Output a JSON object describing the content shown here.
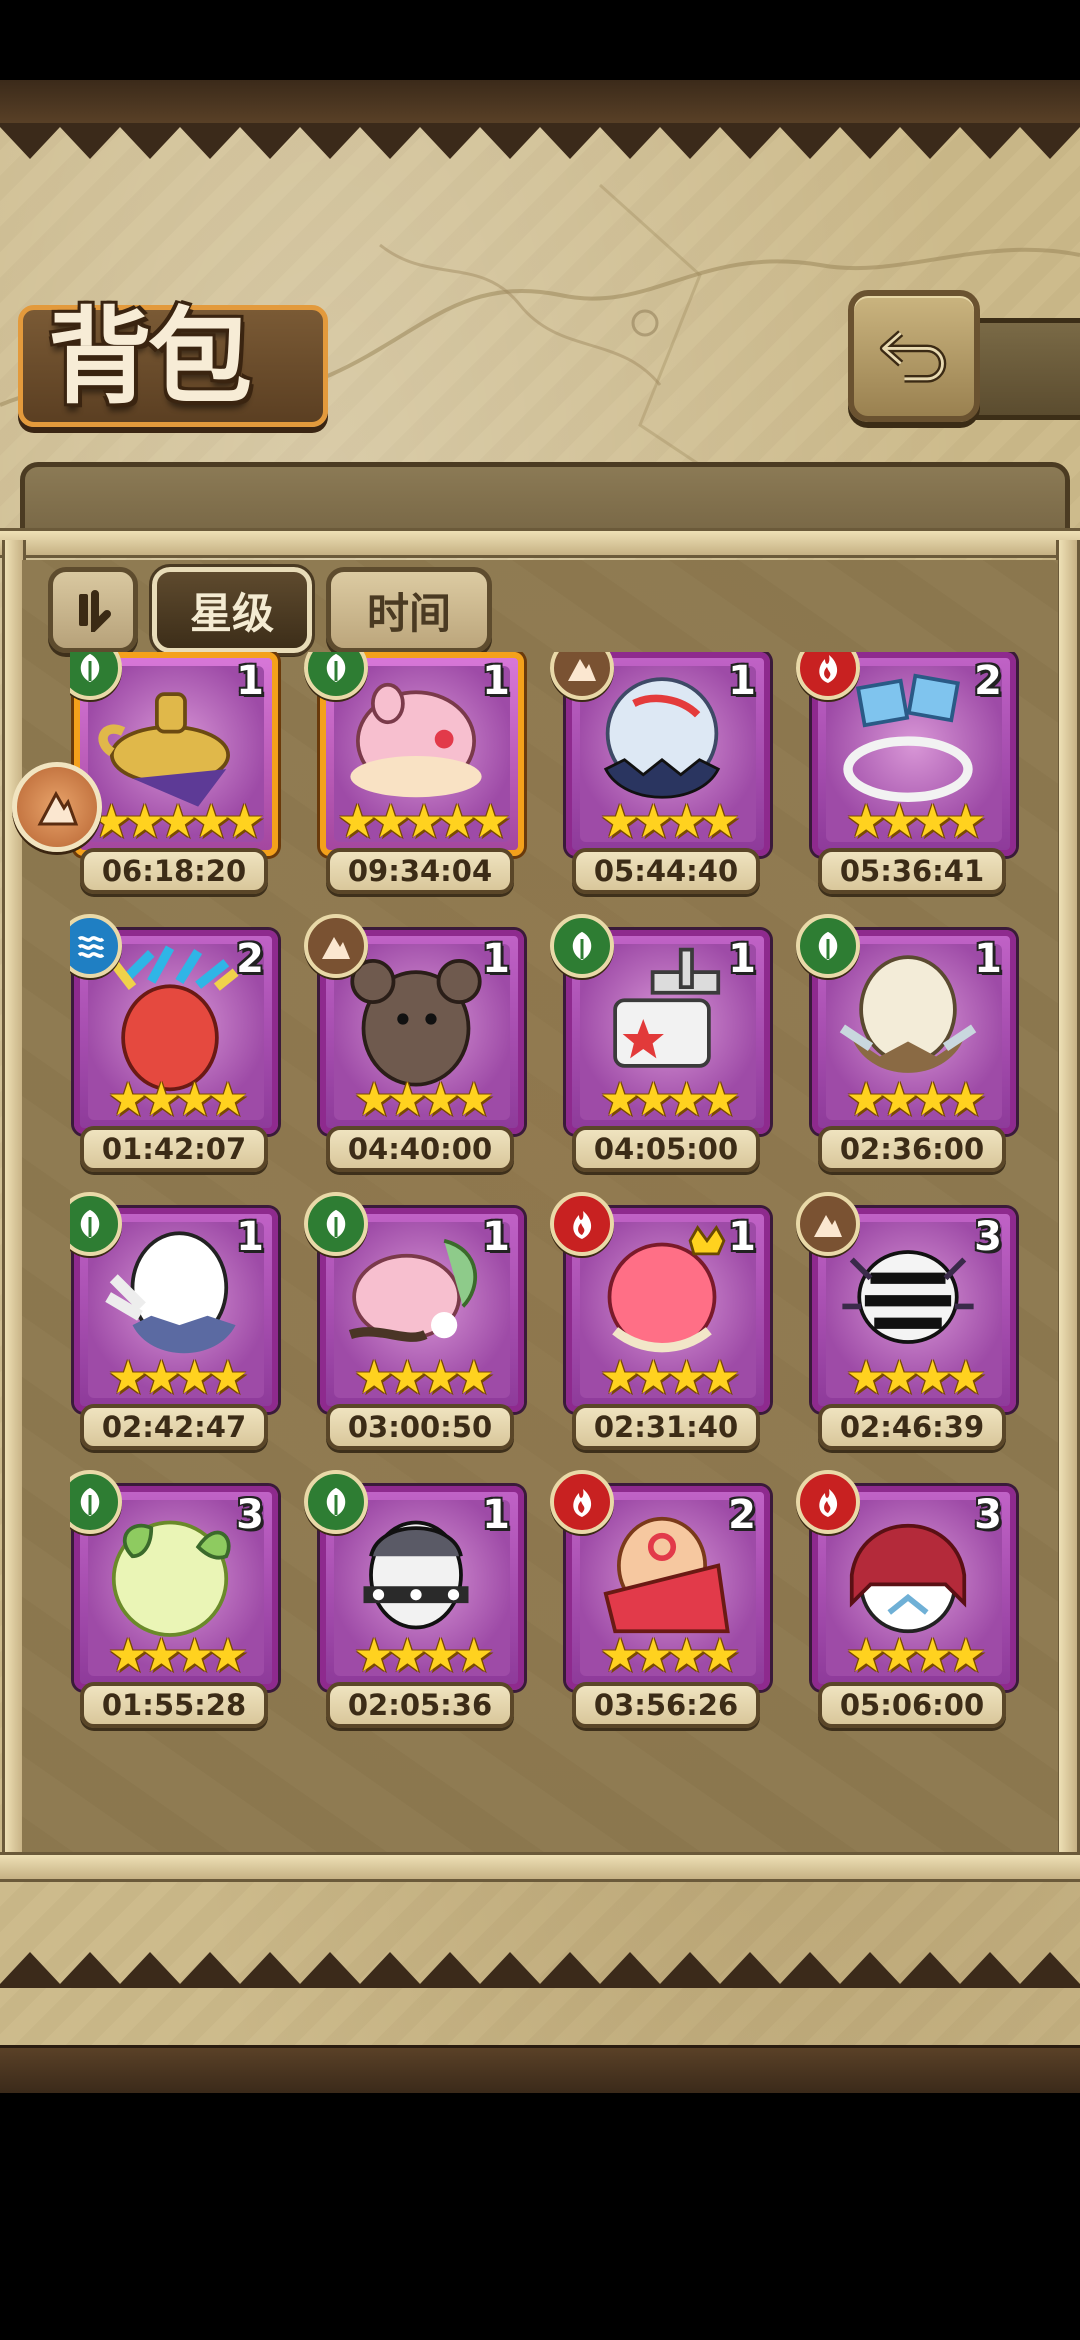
{
  "title": "背包",
  "sort": {
    "star_label": "星级",
    "time_label": "时间",
    "active": "星级"
  },
  "colors": {
    "forest": "#2e7d33",
    "fire": "#c82121",
    "water": "#1f7fc3",
    "earth": "#7a5232",
    "card_purple": "#8e2a8e",
    "card_gold": "#f4a11b",
    "star": "#ffd21f"
  },
  "eggs": [
    {
      "name": "lamp-egg",
      "element": "forest",
      "qty": "1",
      "stars": 5,
      "timer": "06:18:20",
      "frame": "gold"
    },
    {
      "name": "pink-cloud-egg",
      "element": "forest",
      "qty": "1",
      "stars": 5,
      "timer": "09:34:04",
      "frame": "gold"
    },
    {
      "name": "crystal-ball-egg",
      "element": "earth",
      "qty": "1",
      "stars": 4,
      "timer": "05:44:40",
      "frame": "purple"
    },
    {
      "name": "ice-flag-egg",
      "element": "fire",
      "qty": "2",
      "stars": 4,
      "timer": "05:36:41",
      "frame": "purple"
    },
    {
      "name": "feather-egg",
      "element": "water",
      "qty": "2",
      "stars": 4,
      "timer": "01:42:07",
      "frame": "purple"
    },
    {
      "name": "mouse-egg",
      "element": "earth",
      "qty": "1",
      "stars": 4,
      "timer": "04:40:00",
      "frame": "purple"
    },
    {
      "name": "cannon-egg",
      "element": "forest",
      "qty": "1",
      "stars": 4,
      "timer": "04:05:00",
      "frame": "purple"
    },
    {
      "name": "nest-egg",
      "element": "forest",
      "qty": "1",
      "stars": 4,
      "timer": "02:36:00",
      "frame": "purple"
    },
    {
      "name": "wing-egg",
      "element": "forest",
      "qty": "1",
      "stars": 4,
      "timer": "02:42:47",
      "frame": "purple"
    },
    {
      "name": "pink-pig-egg",
      "element": "forest",
      "qty": "1",
      "stars": 4,
      "timer": "03:00:50",
      "frame": "purple"
    },
    {
      "name": "crown-egg",
      "element": "fire",
      "qty": "1",
      "stars": 4,
      "timer": "02:31:40",
      "frame": "purple"
    },
    {
      "name": "spider-egg",
      "element": "earth",
      "qty": "3",
      "stars": 4,
      "timer": "02:46:39",
      "frame": "purple"
    },
    {
      "name": "leaf-egg",
      "element": "forest",
      "qty": "3",
      "stars": 4,
      "timer": "01:55:28",
      "frame": "purple"
    },
    {
      "name": "spiked-egg",
      "element": "forest",
      "qty": "1",
      "stars": 4,
      "timer": "02:05:36",
      "frame": "purple"
    },
    {
      "name": "kimono-egg",
      "element": "fire",
      "qty": "2",
      "stars": 4,
      "timer": "03:56:26",
      "frame": "purple"
    },
    {
      "name": "hood-egg",
      "element": "fire",
      "qty": "3",
      "stars": 4,
      "timer": "05:06:00",
      "frame": "purple"
    }
  ]
}
